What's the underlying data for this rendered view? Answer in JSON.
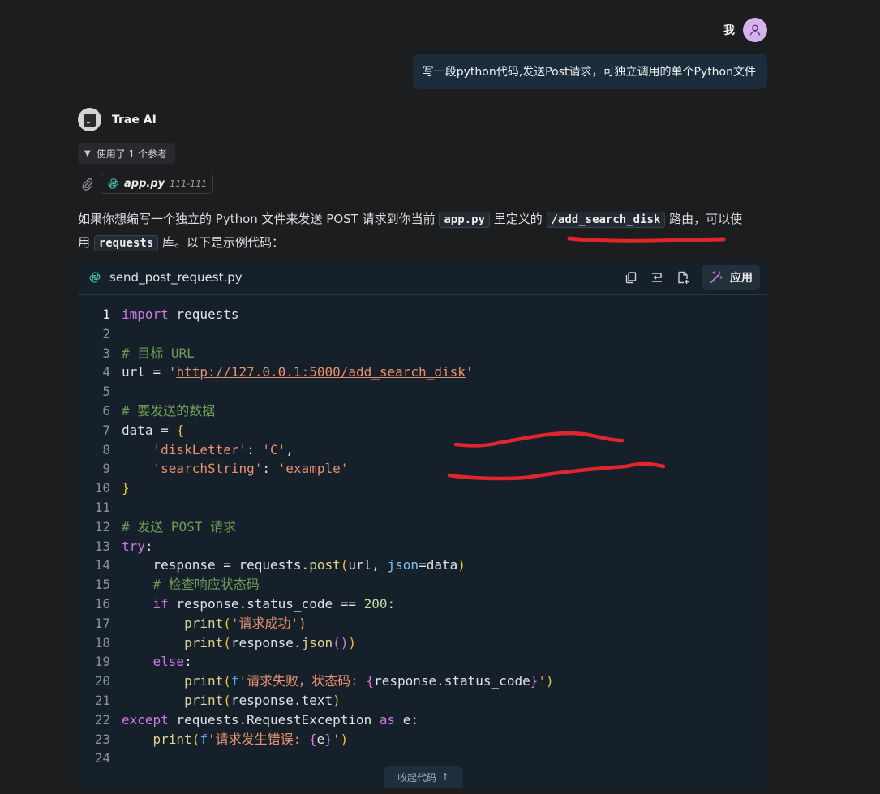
{
  "user": {
    "name": "我",
    "message": "写一段python代码,发送Post请求，可独立调用的单个Python文件"
  },
  "assistant": {
    "name": "Trae AI",
    "references_toggle": "使用了 1 个参考",
    "reference_file": "app.py",
    "reference_range": "111-111",
    "paragraph": {
      "p1": "如果你想编写一个独立的 Python 文件来发送 POST 请求到你当前 ",
      "c1": "app.py",
      "p2": " 里定义的 ",
      "c2": "/add_search_disk",
      "p3": " 路由，可以使用 ",
      "c3": "requests",
      "p4": " 库。以下是示例代码："
    }
  },
  "codeblock": {
    "filename": "send_post_request.py",
    "apply_label": "应用",
    "collapse_label": "收起代码",
    "line_numbers": [
      "1",
      "2",
      "3",
      "4",
      "5",
      "6",
      "7",
      "8",
      "9",
      "10",
      "11",
      "12",
      "13",
      "14",
      "15",
      "16",
      "17",
      "18",
      "19",
      "20",
      "21",
      "22",
      "23",
      "24"
    ],
    "code": {
      "l1_kw": "import",
      "l1_rest": " requests",
      "l3": "# 目标 URL",
      "l4_a": "url = ",
      "l4_q1": "'",
      "l4_url": "http://127.0.0.1:5000/add_search_disk",
      "l4_q2": "'",
      "l6": "# 要发送的数据",
      "l7_a": "data = ",
      "l7_b": "{",
      "l8_k": "'diskLetter'",
      "l8_c": ": ",
      "l8_v": "'C'",
      "l8_e": ",",
      "l9_k": "'searchString'",
      "l9_c": ": ",
      "l9_v": "'example'",
      "l10": "}",
      "l12": "# 发送 POST 请求",
      "l13_kw": "try",
      "l13_c": ":",
      "l14_a": "response = requests.",
      "l14_fn": "post",
      "l14_p1": "(",
      "l14_b": "url, ",
      "l14_kw": "json",
      "l14_c": "=data",
      "l14_p2": ")",
      "l15": "# 检查响应状态码",
      "l16_kw": "if",
      "l16_a": " response.status_code == ",
      "l16_num": "200",
      "l16_c": ":",
      "l17_fn": "print",
      "l17_p1": "(",
      "l17_s": "'请求成功'",
      "l17_p2": ")",
      "l18_fn": "print",
      "l18_p1": "(",
      "l18_a": "response.",
      "l18_fn2": "json",
      "l18_p3": "()",
      "l18_p2": ")",
      "l19_kw": "else",
      "l19_c": ":",
      "l20_fn": "print",
      "l20_p1": "(",
      "l20_f": "f",
      "l20_s1": "'请求失败，状态码: ",
      "l20_b1": "{",
      "l20_v": "response.status_code",
      "l20_b2": "}",
      "l20_s2": "'",
      "l20_p2": ")",
      "l21_fn": "print",
      "l21_p1": "(",
      "l21_a": "response.text",
      "l21_p2": ")",
      "l22_kw": "except",
      "l22_a": " requests.RequestException ",
      "l22_kw2": "as",
      "l22_b": " e:",
      "l23_fn": "print",
      "l23_p1": "(",
      "l23_f": "f",
      "l23_s1": "'请求发生错误: ",
      "l23_b1": "{",
      "l23_v": "e",
      "l23_b2": "}",
      "l23_s2": "'",
      "l23_p2": ")"
    }
  },
  "colors": {
    "background": "#1c1d1f",
    "code_background": "#16202a",
    "keyword": "#c97ae0",
    "comment": "#6f9c58",
    "string": "#e8916f",
    "annotation": "#e0262d"
  },
  "icons": {
    "user_avatar": "person-icon",
    "attachment": "paperclip-icon",
    "file": "python-icon",
    "copy": "copy-icon",
    "insert": "insert-icon",
    "new_file": "new-file-icon",
    "apply": "magic-wand-icon",
    "collapse": "arrow-up-icon"
  }
}
